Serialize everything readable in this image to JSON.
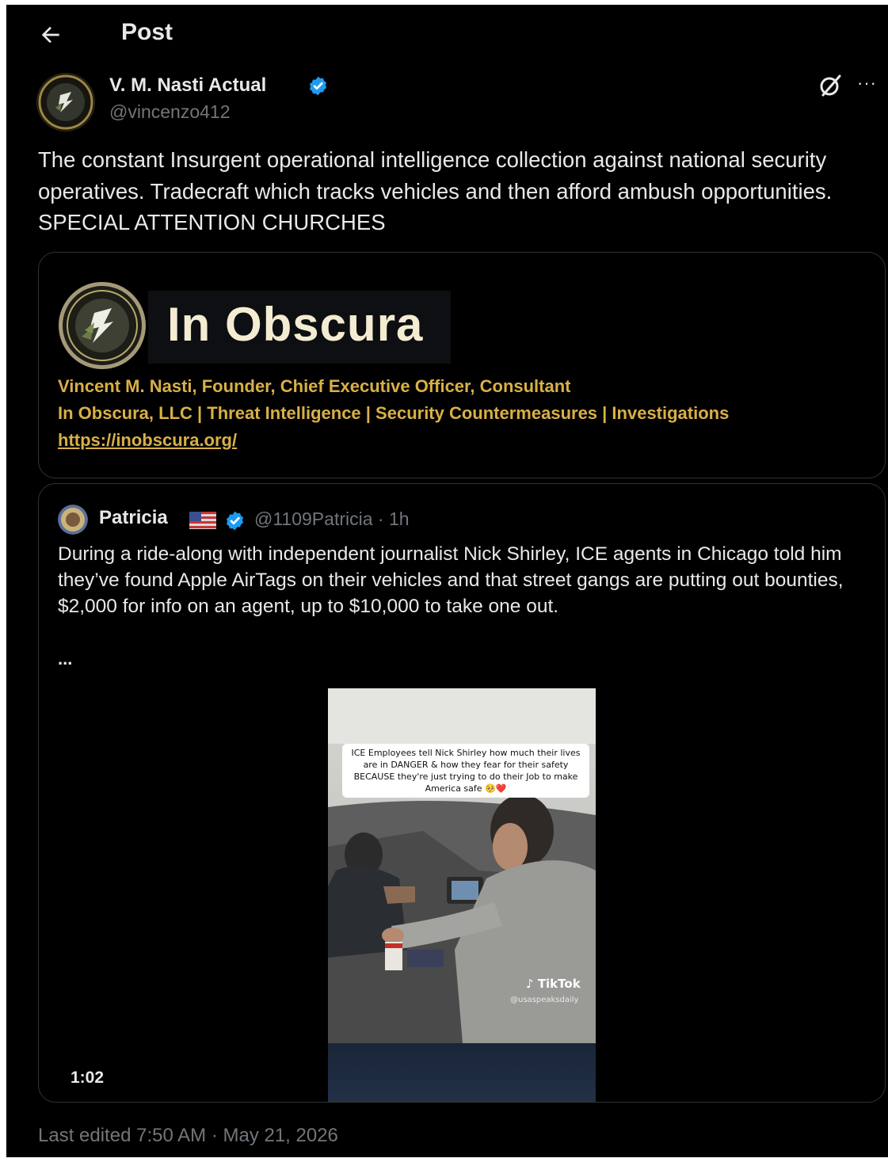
{
  "header": {
    "title": "Post"
  },
  "post": {
    "author_name": "V. M. Nasti Actual",
    "author_handle": "@vincenzo412",
    "text": "The constant Insurgent operational intelligence collection against national security operatives.  Tradecraft which tracks vehicles and then afford ambush opportunities. SPECIAL ATTENTION CHURCHES",
    "more_glyph": "···",
    "footer": "Last edited 7:50 AM · May 21, 2026"
  },
  "card": {
    "brand": "In Obscura",
    "line1": "Vincent M. Nasti, Founder, Chief Executive Officer, Consultant",
    "line2": "In Obscura, LLC | Threat Intelligence | Security Countermeasures | Investigations",
    "link": "https://inobscura.org/"
  },
  "quote": {
    "name": "Patricia",
    "handle": "@1109Patricia",
    "time": "1h",
    "text": "During a ride-along with independent journalist Nick Shirley, ICE agents in Chicago told him they’ve found Apple AirTags on their vehicles and that street gangs are putting out bounties, $2,000 for info on an agent, up to $10,000 to take one out.",
    "ellipsis": "...",
    "video_caption": "ICE Employees tell Nick Shirley how much their lives are in DANGER & how they fear for their safety BECAUSE they're just trying to do their Job to make America safe 🥺❤️",
    "video_watermark": "TikTok",
    "video_watermark_handle": "@usaspeaksdaily",
    "video_duration": "1:02"
  },
  "colors": {
    "background": "#000000",
    "text": "#e7e9ea",
    "muted": "#71767b",
    "verified": "#1d9bf0",
    "card_gold": "#d9b047"
  },
  "icons": [
    "back-arrow-icon",
    "verified-badge-icon",
    "grok-icon",
    "more-icon",
    "us-flag-icon",
    "tiktok-icon"
  ]
}
